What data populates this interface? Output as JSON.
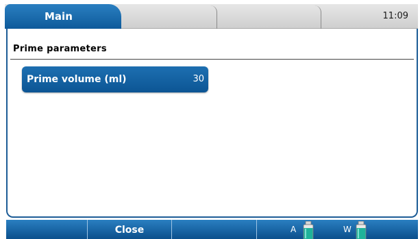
{
  "header": {
    "tabs": [
      {
        "label": "Main",
        "active": true
      },
      {
        "label": "",
        "active": false
      },
      {
        "label": "",
        "active": false
      },
      {
        "label": "",
        "active": false
      }
    ],
    "time": "11:09"
  },
  "panel": {
    "title": "Prime parameters",
    "parameters": [
      {
        "label": "Prime volume (ml)",
        "value": "30"
      }
    ]
  },
  "toolbar": {
    "buttons": [
      {
        "label": ""
      },
      {
        "label": "Close"
      },
      {
        "label": ""
      }
    ],
    "bottles": [
      {
        "label": "A",
        "icon": "bottle-icon"
      },
      {
        "label": "W",
        "icon": "bottle-icon"
      }
    ]
  },
  "colors": {
    "accent": "#0e5a9a",
    "tab_bar": "#d9d9d9",
    "bottle_fill": "#1fb39a"
  }
}
